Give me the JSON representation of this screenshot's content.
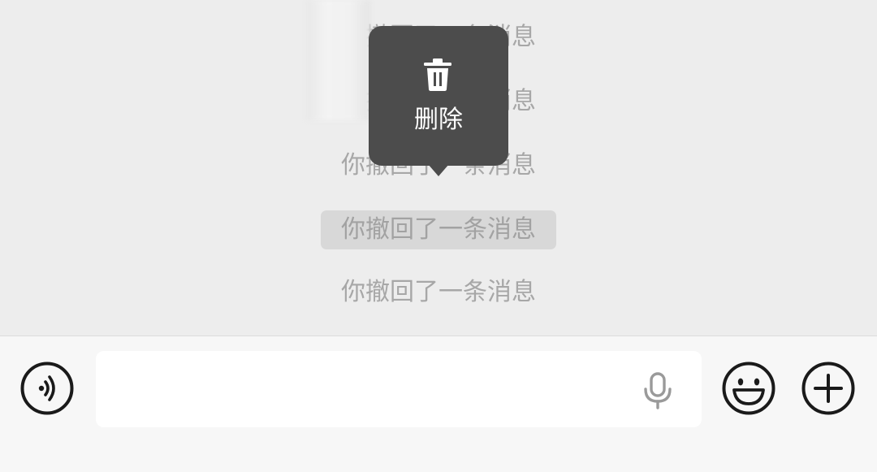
{
  "messages": [
    {
      "text": "你撤回了一条消息",
      "selected": false
    },
    {
      "text": "你撤回了一条消息",
      "selected": false
    },
    {
      "text": "你撤回了一条消息",
      "selected": false
    },
    {
      "text": "你撤回了一条消息",
      "selected": true
    },
    {
      "text": "你撤回了一条消息",
      "selected": false
    }
  ],
  "context_menu": {
    "icon": "trash-icon",
    "label": "删除"
  },
  "input_bar": {
    "text_value": "",
    "voice_icon": "voice-mode-icon",
    "mic_icon": "microphone-icon",
    "emoji_icon": "emoji-icon",
    "plus_icon": "plus-icon"
  },
  "colors": {
    "chat_background": "#ededed",
    "system_text": "#a7a7a7",
    "selected_highlight": "#d8d8d8",
    "popup_background": "#4c4c4c",
    "popup_text": "#ffffff",
    "input_bar_background": "#f7f7f7",
    "icon_color": "#1a1a1a"
  }
}
